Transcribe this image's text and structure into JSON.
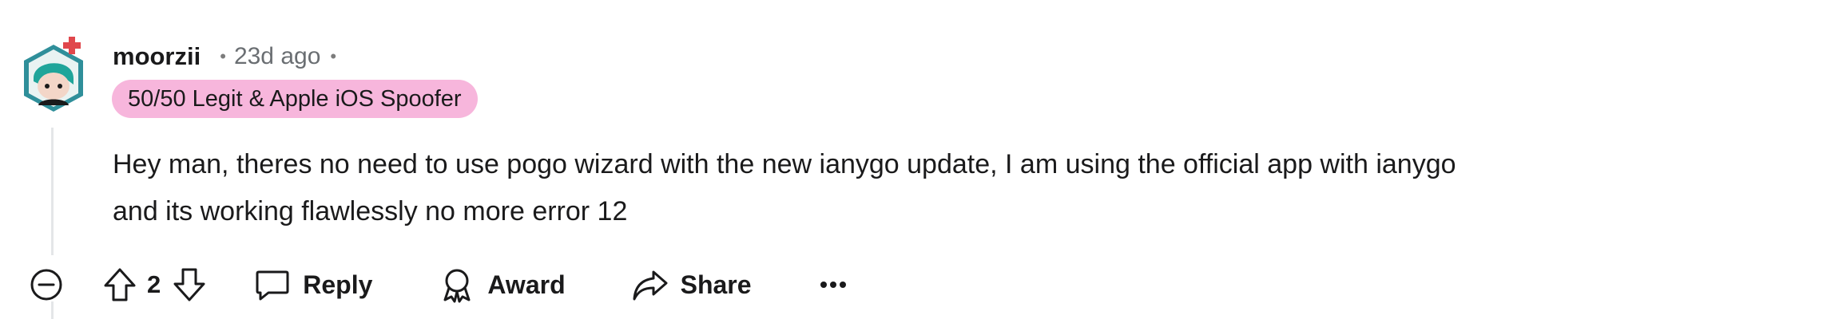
{
  "comment": {
    "username": "moorzii",
    "separator": "•",
    "timestamp": "23d ago",
    "flair": "50/50 Legit & Apple iOS Spoofer",
    "flair_color": "#f7b6dc",
    "avatar_colors": {
      "frame": "#2f8f9a",
      "hair": "#1fa59a",
      "skin": "#f3d6c8",
      "badge": "#e0474c"
    },
    "body_lines": [
      "Hey man, theres no need to use pogo wizard with the new ianygo update, I am using the official app with ianygo",
      "and its working flawlessly no more error 12"
    ]
  },
  "actions": {
    "collapse_icon": "minus-circle-icon",
    "upvote_icon": "upvote-arrow-icon",
    "score": "2",
    "downvote_icon": "downvote-arrow-icon",
    "reply_label": "Reply",
    "reply_icon": "comment-bubble-icon",
    "award_label": "Award",
    "award_icon": "award-medal-icon",
    "share_label": "Share",
    "share_icon": "share-arrow-icon",
    "more_label": "•••",
    "more_icon": "more-options-icon"
  }
}
